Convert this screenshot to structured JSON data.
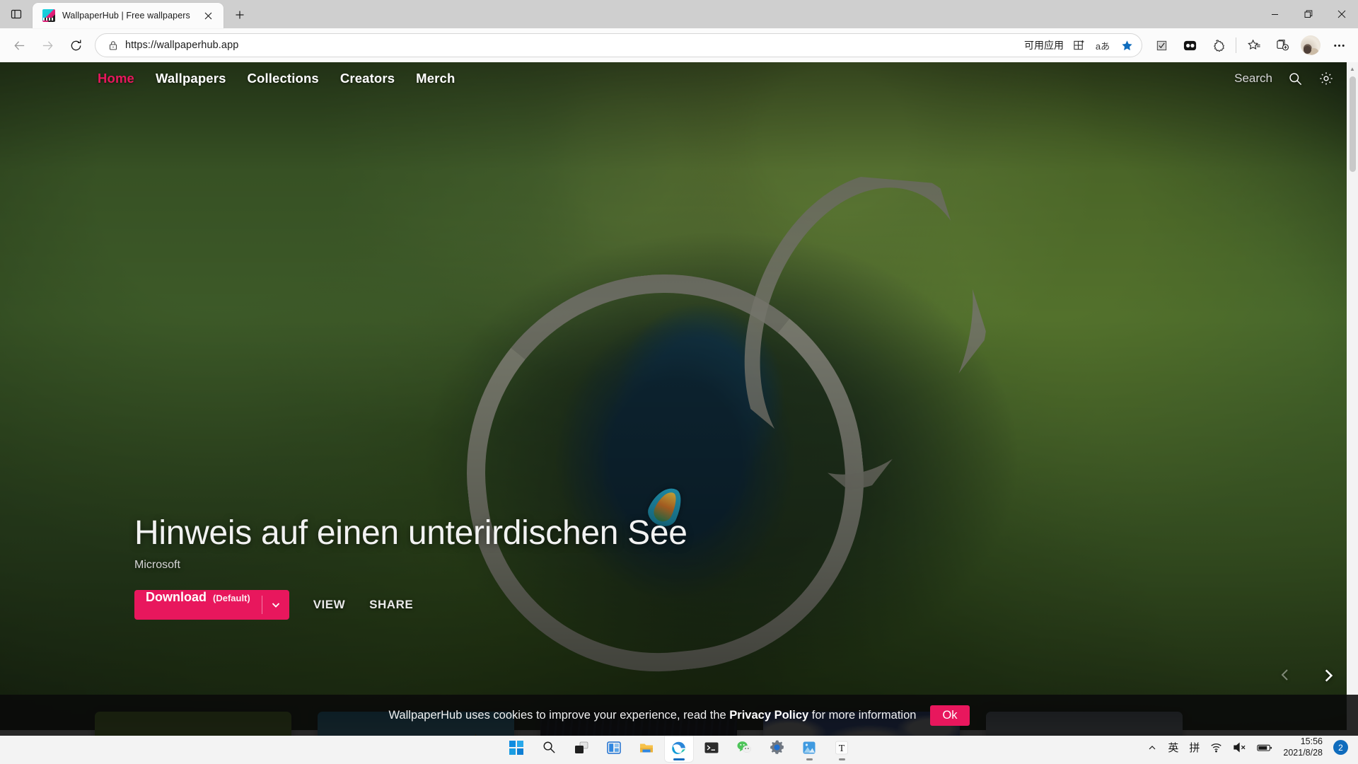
{
  "browser": {
    "tab": {
      "title": "WallpaperHub | Free wallpapers",
      "favicon": "wallpaperhub-favicon"
    },
    "new_tab_label": "+",
    "tab_search_icon": "tab-list-icon",
    "window_controls": {
      "minimize": "minimize-icon",
      "restore": "restore-icon",
      "close": "close-icon"
    },
    "nav": {
      "back": "back-arrow-icon",
      "forward": "forward-arrow-icon",
      "refresh": "refresh-icon"
    },
    "omnibox": {
      "url": "https://wallpaperhub.app",
      "lock_icon": "site-security-lock-icon",
      "apps_label": "可用应用",
      "install_app_icon": "install-app-icon",
      "translate_icon": "translate-icon",
      "favorite_icon": "star-filled-icon"
    },
    "toolbar_icons": [
      "immersive-reader-icon",
      "extension-dark-icon",
      "extensions-puzzle-icon",
      "favorites-icon",
      "collections-icon",
      "profile-avatar",
      "settings-more-icon"
    ],
    "scrollbar": {
      "up_arrow": "scroll-up-arrow"
    }
  },
  "site": {
    "nav_links": [
      {
        "label": "Home",
        "active": true
      },
      {
        "label": "Wallpapers",
        "active": false
      },
      {
        "label": "Collections",
        "active": false
      },
      {
        "label": "Creators",
        "active": false
      },
      {
        "label": "Merch",
        "active": false
      }
    ],
    "search_placeholder": "Search",
    "search_icon": "search-icon",
    "settings_icon": "gear-icon",
    "hero": {
      "title": "Hinweis auf einen unterirdischen See",
      "author": "Microsoft",
      "download_label": "Download",
      "download_default": "(Default)",
      "download_caret": "chevron-down-icon",
      "view_label": "VIEW",
      "share_label": "SHARE",
      "accent_color": "#e8175d"
    },
    "carousel": {
      "prev_icon": "chevron-left-icon",
      "next_icon": "chevron-right-icon",
      "thumbnails": [
        {
          "name": "green-field-thumbnail"
        },
        {
          "name": "golden-temple-thumbnail"
        },
        {
          "name": "dark-abstract-thumbnail"
        },
        {
          "name": "blue-clouds-thumbnail"
        },
        {
          "name": "sunset-landscape-thumbnail"
        }
      ]
    },
    "cookie_banner": {
      "text_before": "WallpaperHub uses cookies to improve your experience, read the ",
      "link": "Privacy Policy",
      "text_after": " for more information",
      "ok_label": "Ok"
    }
  },
  "taskbar": {
    "apps": [
      {
        "name": "start-button"
      },
      {
        "name": "search-taskbar-icon"
      },
      {
        "name": "task-view-icon"
      },
      {
        "name": "widgets-icon"
      },
      {
        "name": "file-explorer-icon"
      },
      {
        "name": "edge-browser-icon",
        "active": true
      },
      {
        "name": "terminal-icon"
      },
      {
        "name": "wechat-icon"
      },
      {
        "name": "settings-icon"
      },
      {
        "name": "photos-icon",
        "running": true
      },
      {
        "name": "text-editor-icon",
        "running": true
      }
    ],
    "tray": {
      "overflow_icon": "chevron-up-icon",
      "ime_lang": "英",
      "ime_mode": "拼",
      "wifi_icon": "wifi-icon",
      "volume_icon": "volume-muted-icon",
      "battery_icon": "battery-icon",
      "time": "15:56",
      "date": "2021/8/28",
      "notification_count": "2"
    }
  }
}
